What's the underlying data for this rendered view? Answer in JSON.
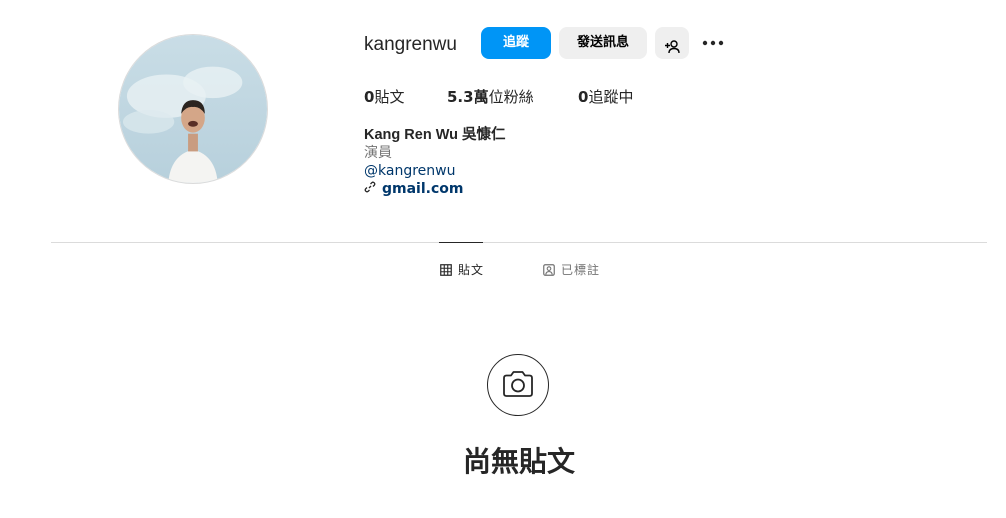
{
  "profile": {
    "username": "kangrenwu",
    "avatar_icon": "profile-photo"
  },
  "actions": {
    "follow_label": "追蹤",
    "message_label": "發送訊息",
    "add_user_icon": "add-user-icon",
    "more_icon": "more-horizontal-icon"
  },
  "stats": {
    "posts_count": "0",
    "posts_label": "貼文",
    "followers_count": "5.3萬",
    "followers_label": "位粉絲",
    "following_count": "0",
    "following_label": "追蹤中"
  },
  "bio": {
    "name": "Kang Ren Wu 吳慷仁",
    "category": "演員",
    "handle": "@kangrenwu",
    "link": "gmail.com",
    "link_icon": "link-icon"
  },
  "tabs": [
    {
      "label": "貼文",
      "icon": "grid-icon",
      "active": true
    },
    {
      "label": "已標註",
      "icon": "tagged-icon",
      "active": false
    }
  ],
  "empty_state": {
    "icon": "camera-icon",
    "title": "尚無貼文"
  },
  "colors": {
    "accent": "#0095f6",
    "secondary_button": "#efefef",
    "link": "#00376b",
    "muted_text": "#737373",
    "divider": "#dbdbdb"
  }
}
